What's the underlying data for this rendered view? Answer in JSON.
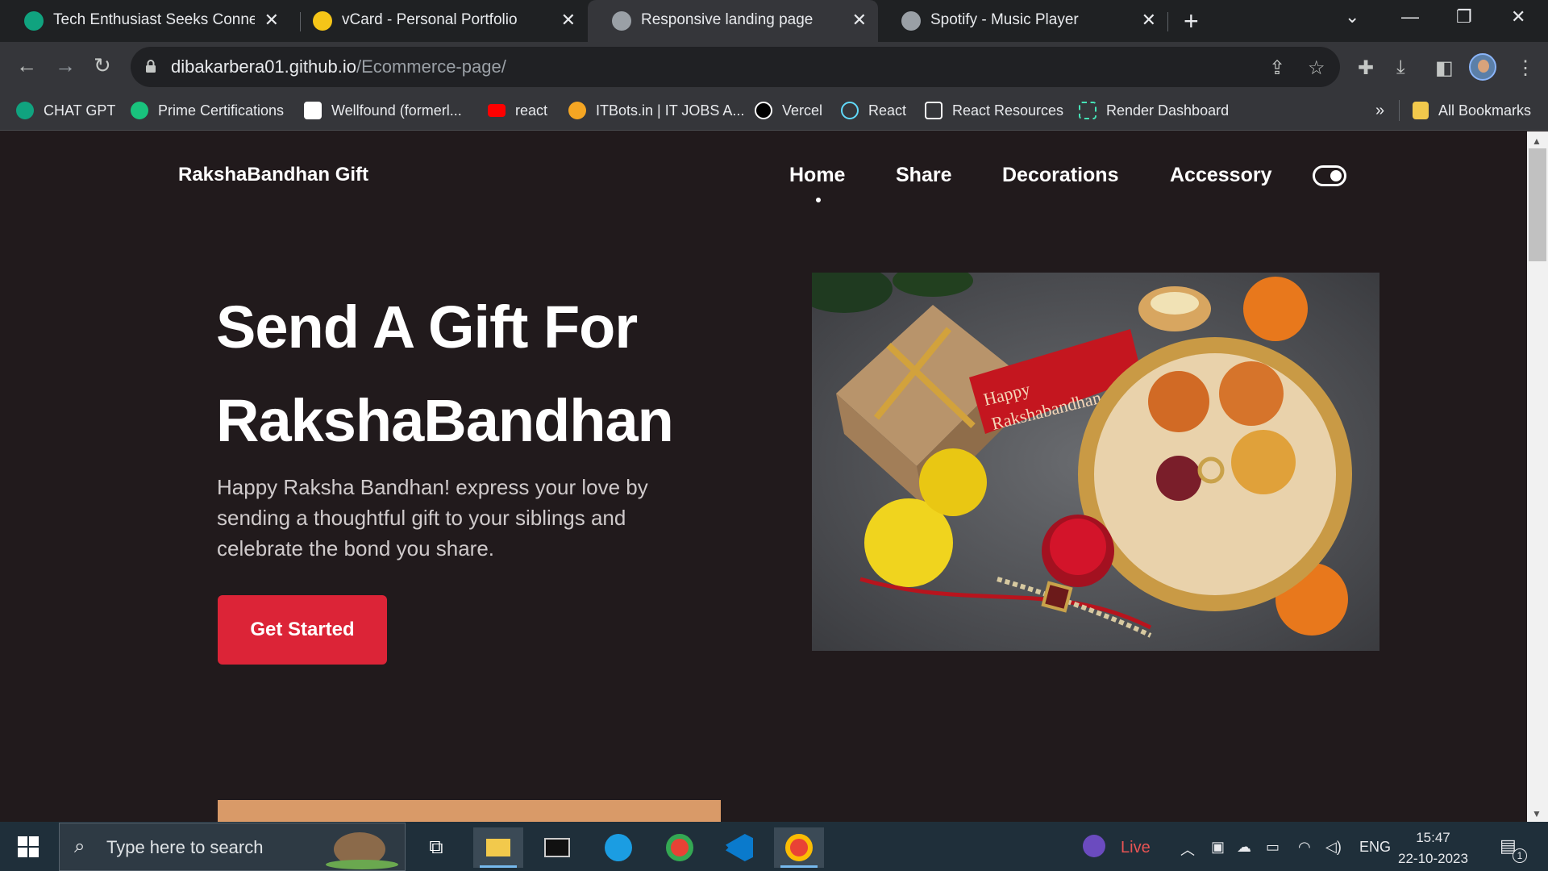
{
  "browser": {
    "tabs": [
      {
        "title": "Tech Enthusiast Seeks Connectio",
        "favicon": "chatgpt-icon"
      },
      {
        "title": "vCard - Personal Portfolio",
        "favicon": "vcard-icon"
      },
      {
        "title": "Responsive landing page",
        "favicon": "globe-icon"
      },
      {
        "title": "Spotify - Music Player",
        "favicon": "globe-icon"
      }
    ],
    "url_host": "dibakarbera01.github.io",
    "url_path": "/Ecommerce-page/",
    "bookmarks": [
      {
        "label": "CHAT GPT",
        "color": "#10a37f"
      },
      {
        "label": "Prime Certifications",
        "color": "#19c37d"
      },
      {
        "label": "Wellfound (formerl...",
        "color": "#ffffff"
      },
      {
        "label": "react",
        "color": "#ff0000"
      },
      {
        "label": "ITBots.in | IT JOBS A...",
        "color": "#f5a623"
      },
      {
        "label": "Vercel",
        "color": "#000000"
      },
      {
        "label": "React",
        "color": "#61dafb"
      },
      {
        "label": "React Resources",
        "color": "#ffffff"
      },
      {
        "label": "Render Dashboard",
        "color": "#46e3b7"
      }
    ],
    "bookmarks_overflow": "»",
    "all_bookmarks": "All Bookmarks"
  },
  "site": {
    "brand": "RakshaBandhan Gift",
    "nav": [
      "Home",
      "Share",
      "Decorations",
      "Accessory"
    ],
    "hero": {
      "title_line1": "Send A Gift For",
      "title_line2": "RakshaBandhan",
      "description": "Happy Raksha Bandhan! express your love by sending a thoughtful gift to your siblings and celebrate the bond you share.",
      "cta": "Get Started",
      "image_tag_text": "Happy Rakshabandhan"
    },
    "colors": {
      "background": "#211a1c",
      "accent": "#dc2437",
      "text": "#ffffff"
    }
  },
  "taskbar": {
    "search_placeholder": "Type here to search",
    "live_label": "Live",
    "lang": "ENG",
    "time": "15:47",
    "date": "22-10-2023",
    "notification_count": "1"
  }
}
